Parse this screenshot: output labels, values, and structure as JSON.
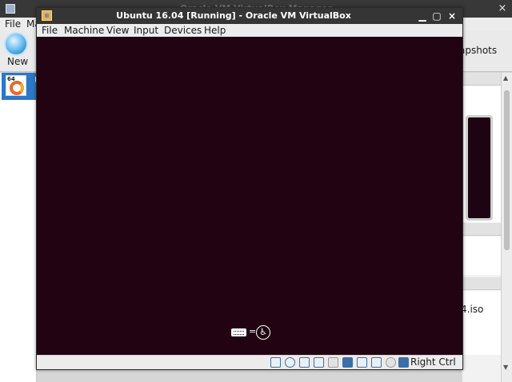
{
  "manager": {
    "title": "Oracle VM VirtualBox Manager",
    "menu": [
      "File",
      "Ma"
    ],
    "toolbar": {
      "new_label": "New",
      "snapshots_label": "apshots"
    },
    "vm_list": [
      {
        "name": "U",
        "arch_badge": "64",
        "os_icon": "ubuntu-icon"
      }
    ],
    "details_text": "4.iso",
    "close_glyph": "×"
  },
  "vm_window": {
    "title": "Ubuntu 16.04 [Running] - Oracle VM VirtualBox",
    "controls": {
      "minimize": "▁",
      "maximize": "▢",
      "close": "×"
    },
    "menu": [
      "File",
      "Machine",
      "View",
      "Input",
      "Devices",
      "Help"
    ],
    "screen": {
      "background_color": "#210311",
      "indicators": {
        "separator": "=",
        "accessibility_glyph": "♿"
      }
    },
    "statusbar": {
      "icons": [
        "hard-disk-icon",
        "optical-drive-icon",
        "audio-icon",
        "network-icon",
        "usb-icon",
        "shared-folders-icon",
        "display-icon",
        "video-capture-icon",
        "mouse-integration-icon",
        "keyboard-capture-icon"
      ],
      "host_key_label": "Right Ctrl"
    }
  },
  "colors": {
    "titlebar": "#353535",
    "selection": "#2a78c8",
    "guest_screen": "#210311"
  }
}
